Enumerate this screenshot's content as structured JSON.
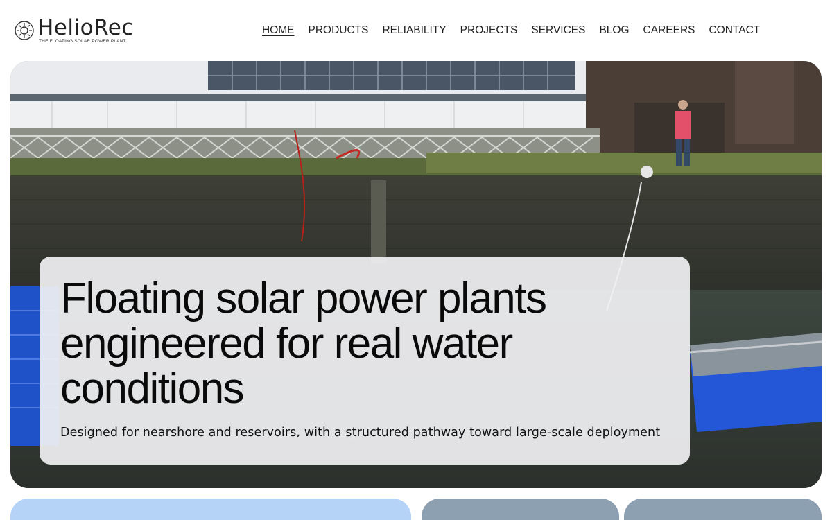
{
  "brand": {
    "name": "HelioRec",
    "tagline": "THE FLOATING SOLAR POWER PLANT",
    "logo_icon": "sun-icon"
  },
  "nav": {
    "items": [
      {
        "label": "HOME",
        "active": true
      },
      {
        "label": "PRODUCTS",
        "active": false
      },
      {
        "label": "RELIABILITY",
        "active": false
      },
      {
        "label": "PROJECTS",
        "active": false
      },
      {
        "label": "SERVICES",
        "active": false
      },
      {
        "label": "BLOG",
        "active": false
      },
      {
        "label": "CAREERS",
        "active": false
      },
      {
        "label": "CONTACT",
        "active": false
      }
    ]
  },
  "hero": {
    "title": "Floating solar power plants engineered for real water conditions",
    "subtitle": "Designed for nearshore and reservoirs, with a structured pathway toward large-scale deployment"
  },
  "colors": {
    "card_primary": "#b4d3f6",
    "card_secondary": "#8da0b1",
    "hero_card_bg": "#f0f0f2"
  }
}
